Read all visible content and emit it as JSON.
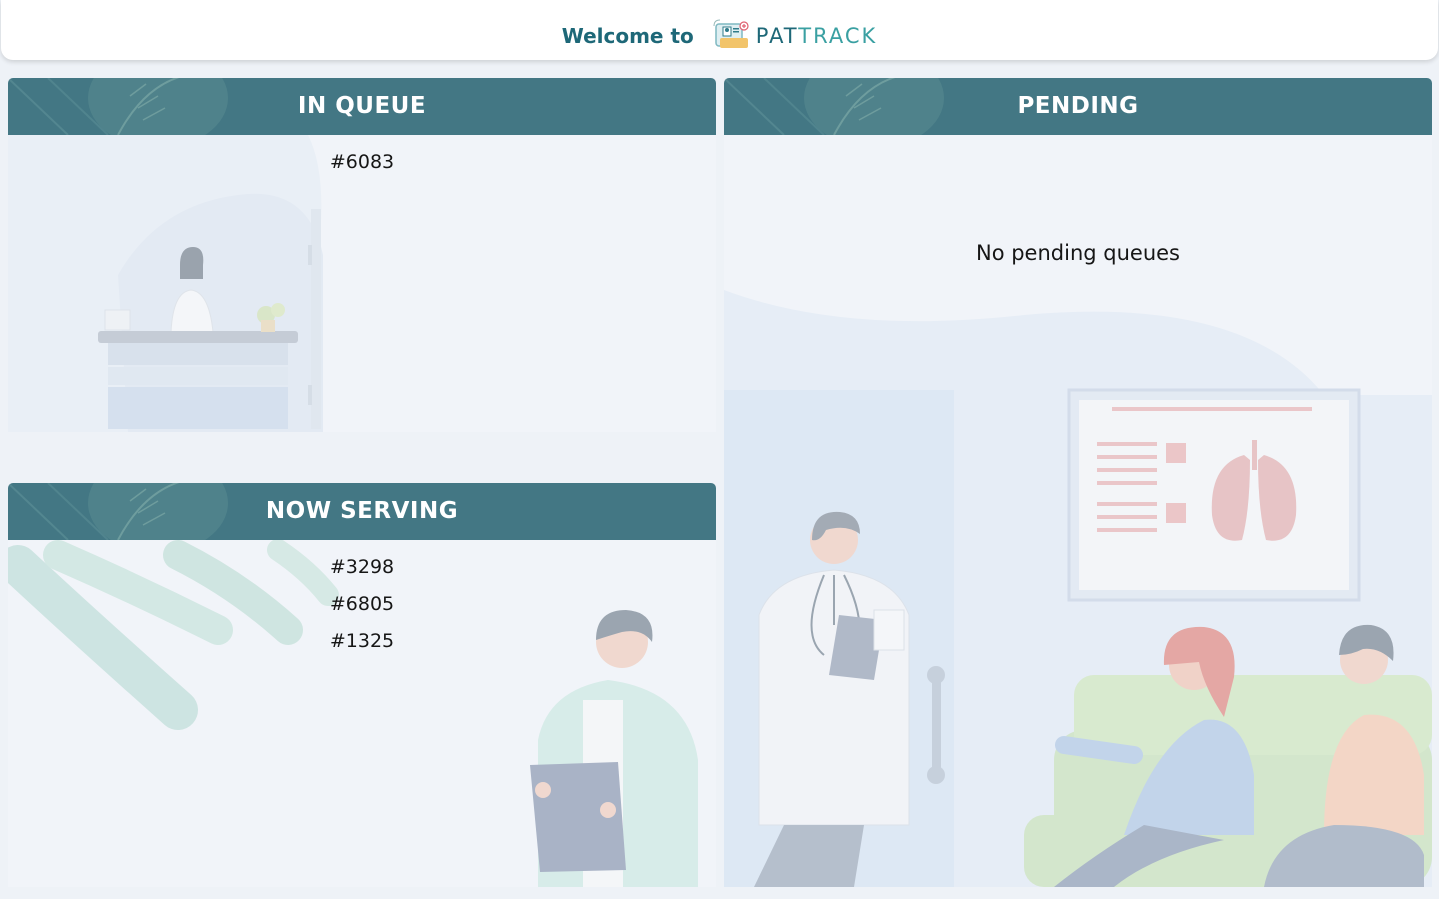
{
  "header": {
    "welcome_text": "Welcome to",
    "logo_text_a": "PAT",
    "logo_text_b": "TRACK"
  },
  "in_queue": {
    "title": "IN QUEUE",
    "tickets": [
      "#6083"
    ]
  },
  "now_serving": {
    "title": "NOW SERVING",
    "tickets": [
      "#3298",
      "#6805",
      "#1325"
    ]
  },
  "pending": {
    "title": "PENDING",
    "empty_message": "No pending queues"
  },
  "colors": {
    "header_bar": "#437784",
    "brand_dark": "#1e6878",
    "brand_light": "#3aa0a2",
    "page_bg": "#eef2f7"
  }
}
